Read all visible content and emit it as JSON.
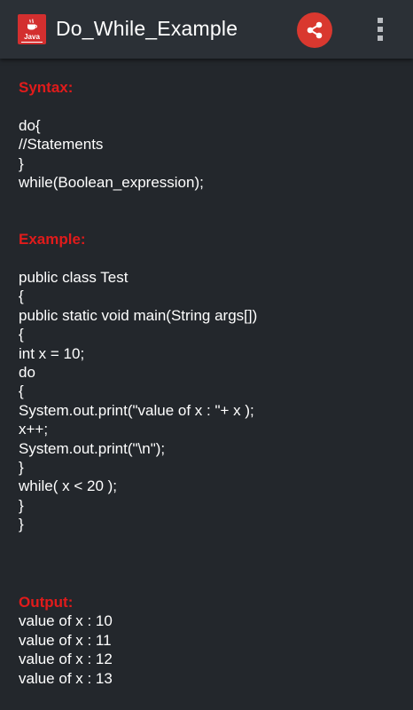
{
  "toolbar": {
    "app_icon_label": "Java",
    "title": "Do_While_Example",
    "share_icon": "share-icon",
    "overflow_icon": "overflow-menu-icon"
  },
  "syntax": {
    "heading": "Syntax:",
    "lines": [
      "do{",
      "//Statements",
      "}",
      "while(Boolean_expression);"
    ]
  },
  "example": {
    "heading": "Example:",
    "lines": [
      "public class Test",
      "{",
      "public static void main(String args[])",
      "{",
      "int x = 10;",
      "do",
      "{",
      "System.out.print(\"value of x : \"+ x );",
      "x++;",
      "System.out.print(\"\\n\");",
      "}",
      "while( x < 20 );",
      "}",
      "}"
    ]
  },
  "output": {
    "heading": "Output:",
    "lines": [
      "value of x : 10",
      "value of x : 11",
      "value of x : 12",
      "value of x : 13"
    ]
  },
  "colors": {
    "background": "#23272c",
    "toolbar": "#2b3036",
    "heading": "#e11b1b",
    "accent": "#d9382f"
  }
}
